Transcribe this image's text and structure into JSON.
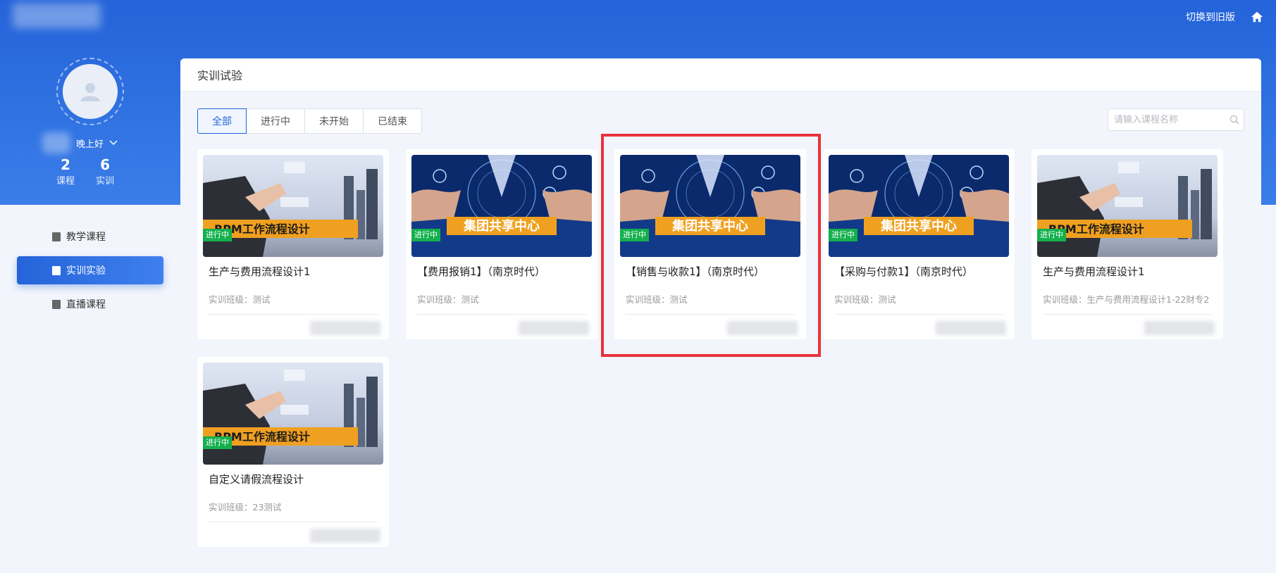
{
  "header": {
    "switch_label": "切换到旧版",
    "home_icon": "home-icon"
  },
  "profile": {
    "greeting": "晚上好",
    "stats": [
      {
        "value": "2",
        "label": "课程"
      },
      {
        "value": "6",
        "label": "实训"
      }
    ]
  },
  "sidebar": {
    "items": [
      {
        "label": "教学课程",
        "icon": "book-icon",
        "active": false
      },
      {
        "label": "实训实验",
        "icon": "monitor-icon",
        "active": true
      },
      {
        "label": "直播课程",
        "icon": "video-icon",
        "active": false
      }
    ]
  },
  "main": {
    "title": "实训试验",
    "tabs": [
      "全部",
      "进行中",
      "未开始",
      "已结束"
    ],
    "active_tab": "全部",
    "search_placeholder": "请输入课程名称",
    "cards": [
      {
        "title": "生产与费用流程设计1",
        "class_text": "实训班级：测试",
        "status": "进行中",
        "banner": "BPM工作流程设计",
        "theme": "bpm"
      },
      {
        "title": "【费用报销1】（南京时代）",
        "class_text": "实训班级：测试",
        "status": "进行中",
        "banner": "集团共享中心",
        "theme": "share"
      },
      {
        "title": "【销售与收款1】（南京时代）",
        "class_text": "实训班级：测试",
        "status": "进行中",
        "banner": "集团共享中心",
        "theme": "share"
      },
      {
        "title": "【采购与付款1】（南京时代）",
        "class_text": "实训班级：测试",
        "status": "进行中",
        "banner": "集团共享中心",
        "theme": "share"
      },
      {
        "title": "生产与费用流程设计1",
        "class_text": "实训班级：生产与费用流程设计1-22财专2",
        "status": "进行中",
        "banner": "BPM工作流程设计",
        "theme": "bpm"
      },
      {
        "title": "自定义请假流程设计",
        "class_text": "实训班级：23测试",
        "status": "进行中",
        "banner": "BPM工作流程设计",
        "theme": "bpm"
      }
    ]
  },
  "colors": {
    "primary": "#2463d9",
    "status_green": "#14b04d",
    "highlight_red": "#e8333a",
    "banner_orange": "#f0a020"
  }
}
